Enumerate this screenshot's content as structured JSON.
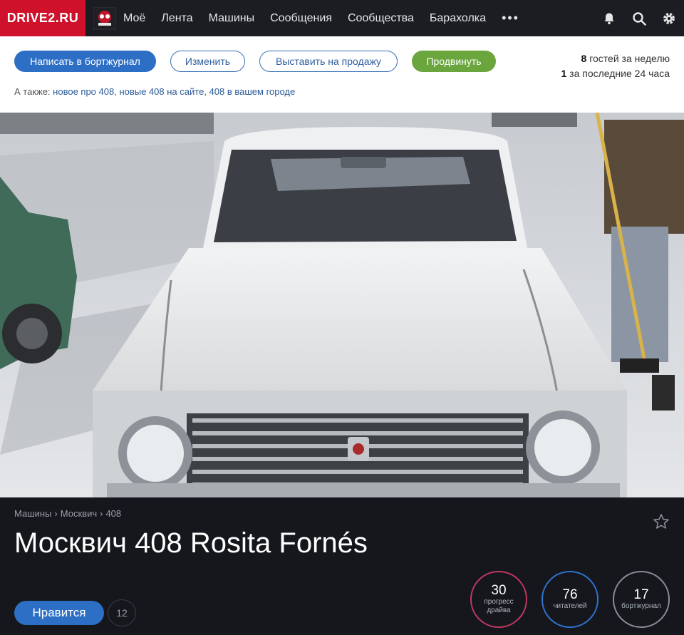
{
  "nav": {
    "logo": "DRIVE2.RU",
    "items": [
      "Моё",
      "Лента",
      "Машины",
      "Сообщения",
      "Сообщества",
      "Барахолка"
    ],
    "more": "•••",
    "icons": [
      "bell-icon",
      "search-icon",
      "gear-icon"
    ]
  },
  "actions": {
    "write_label": "Написать в бортжурнал",
    "edit_label": "Изменить",
    "sell_label": "Выставить на продажу",
    "promote_label": "Продвинуть"
  },
  "stats": {
    "week_count": "8",
    "week_text": "гостей за неделю",
    "day_count": "1",
    "day_text": "за последние 24 часа"
  },
  "also": {
    "prefix": "А также:",
    "links": [
      "новое про 408",
      "новые 408 на сайте",
      "408 в вашем городе"
    ]
  },
  "breadcrumb": [
    "Машины",
    "Москвич",
    "408"
  ],
  "car": {
    "title": "Москвич 408 Rosita Fornés"
  },
  "like": {
    "label": "Нравится",
    "count": "12"
  },
  "counters": [
    {
      "value": "30",
      "label_1": "прогресс",
      "label_2": "драйва",
      "color": "#c2385f"
    },
    {
      "value": "76",
      "label_1": "читателей",
      "label_2": "",
      "color": "#2f74d0"
    },
    {
      "value": "17",
      "label_1": "бортжурнал",
      "label_2": "",
      "color": "#8a8e95"
    }
  ],
  "colors": {
    "brand": "#d0112b",
    "primary": "#2e6fc6",
    "promote": "#6aa63d",
    "nav_bg": "#1b1d22",
    "footer_bg": "#15171d"
  }
}
